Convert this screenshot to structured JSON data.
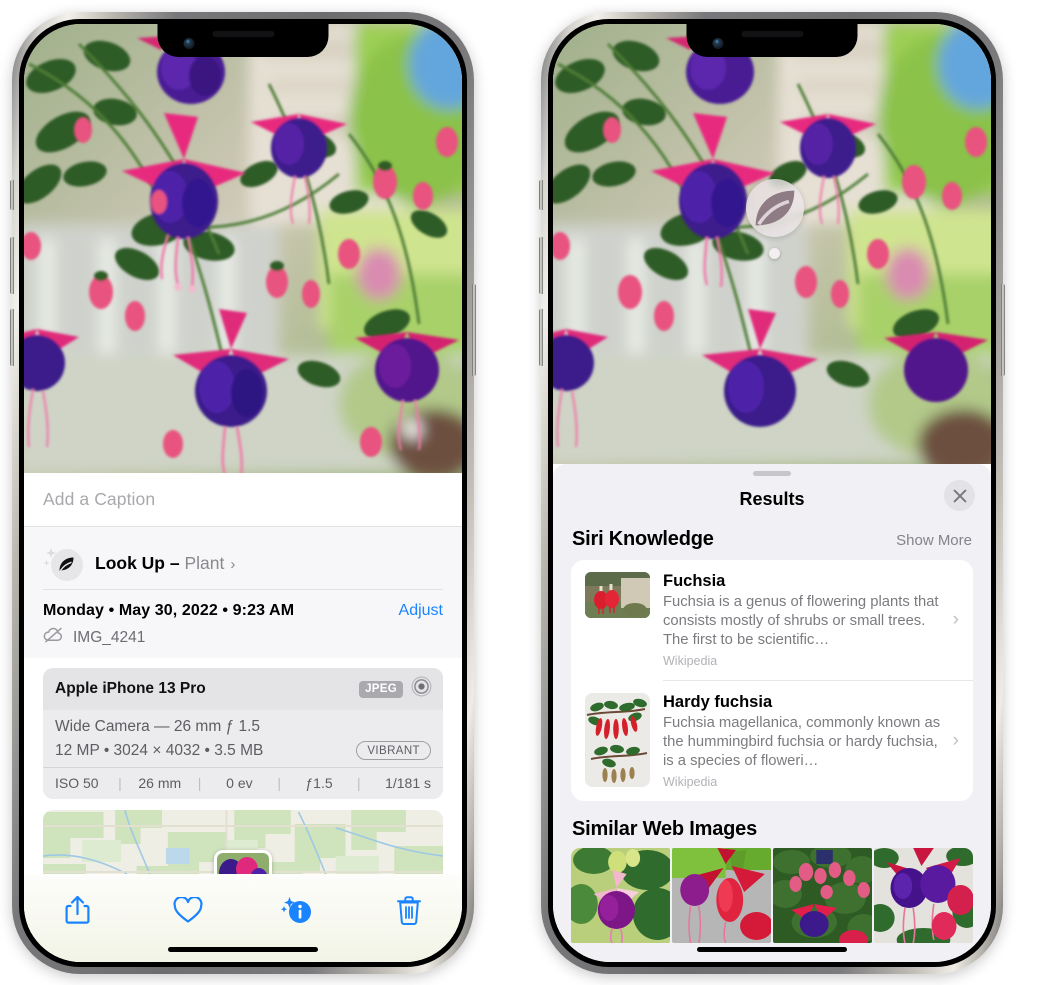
{
  "left_phone": {
    "caption": {
      "placeholder": "Add a Caption",
      "value": ""
    },
    "lookup": {
      "label": "Look Up",
      "dash": " – ",
      "subject": "Plant",
      "chevron": "›",
      "icon": "leaf-sparkle-icon"
    },
    "meta": {
      "date": "Monday • May 30, 2022 • 9:23 AM",
      "adjust": "Adjust",
      "filename": "IMG_4241",
      "cloud_icon": "cloud-slash-icon"
    },
    "camera": {
      "model": "Apple iPhone 13 Pro",
      "format_badge": "JPEG",
      "aperture_icon": "concentric-circle-icon",
      "lens_line": "Wide Camera — 26 mm ƒ 1.5",
      "size_line": "12 MP • 3024 × 4032 • 3.5 MB",
      "style_badge": "VIBRANT",
      "exif": [
        "ISO 50",
        "26 mm",
        "0 ev",
        "ƒ1.5",
        "1/181 s"
      ],
      "exif_separator": "|"
    },
    "toolbar": [
      {
        "name": "share-button",
        "icon": "share-icon"
      },
      {
        "name": "favorite-button",
        "icon": "heart-icon"
      },
      {
        "name": "info-button",
        "icon": "info-sparkle-icon"
      },
      {
        "name": "delete-button",
        "icon": "trash-icon"
      }
    ],
    "accent_color": "#1a84ff"
  },
  "right_phone": {
    "visual_lookup_badge": {
      "icon": "leaf-icon"
    },
    "sheet": {
      "title": "Results",
      "close_icon": "close-icon",
      "sections": [
        {
          "title": "Siri Knowledge",
          "action": "Show More",
          "items": [
            {
              "title": "Fuchsia",
              "description": "Fuchsia is a genus of flowering plants that consists mostly of shrubs or small trees. The first to be scientific…",
              "source": "Wikipedia",
              "chevron": "›",
              "thumb": "fuchsia-red-flowers-thumb"
            },
            {
              "title": "Hardy fuchsia",
              "description": "Fuchsia magellanica, commonly known as the hummingbird fuchsia or hardy fuchsia, is a species of floweri…",
              "source": "Wikipedia",
              "chevron": "›",
              "thumb": "hardy-fuchsia-specimen-thumb"
            }
          ]
        },
        {
          "title": "Similar Web Images",
          "images": [
            "fuchsia-white-purple-thumb",
            "fuchsia-red-closeup-thumb",
            "fuchsia-bush-thumb",
            "fuchsia-purple-red-thumb"
          ]
        }
      ]
    }
  },
  "colors": {
    "accent": "#1a84ff",
    "sheet_bg": "#f1f1f5",
    "card_bg": "#ffffff",
    "secondary_text": "#7b7b80",
    "tertiary_text": "#b2b2b7"
  }
}
